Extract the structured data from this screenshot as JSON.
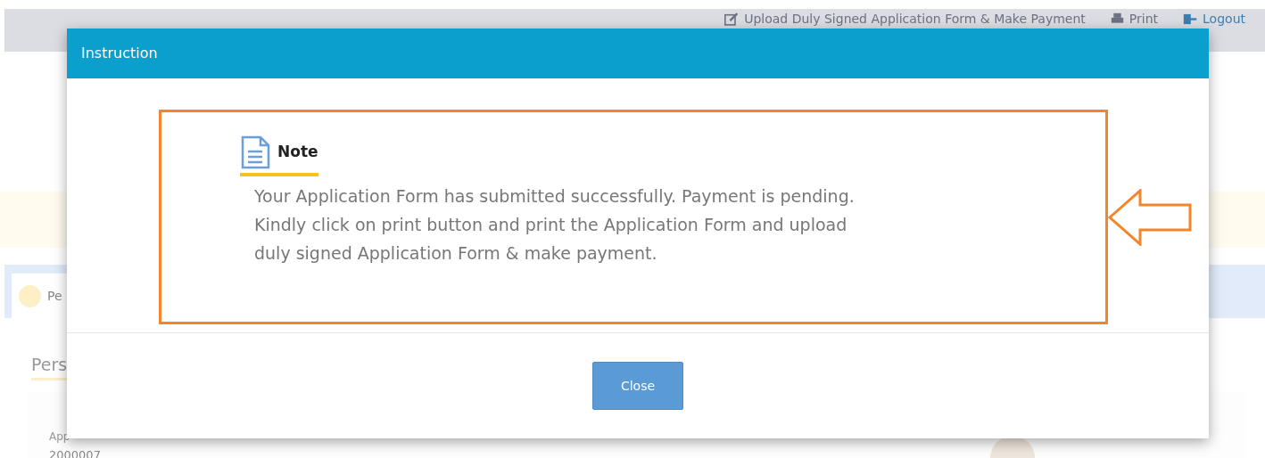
{
  "top_nav": [
    {
      "label": "Upload Duly Signed Application Form & Make Payment"
    },
    {
      "label": "Print"
    },
    {
      "label": "Logout"
    }
  ],
  "page": {
    "tab": {
      "label": "Pe"
    },
    "section_title": "Pers",
    "field": {
      "label": "App",
      "value": "2000007"
    }
  },
  "modal": {
    "title": "Instruction",
    "note_title": "Note",
    "message": "Your Application Form has submitted successfully. Payment is pending. Kindly click on print button and print the Application Form and upload duly signed Application Form & make payment.",
    "button": "Close"
  }
}
